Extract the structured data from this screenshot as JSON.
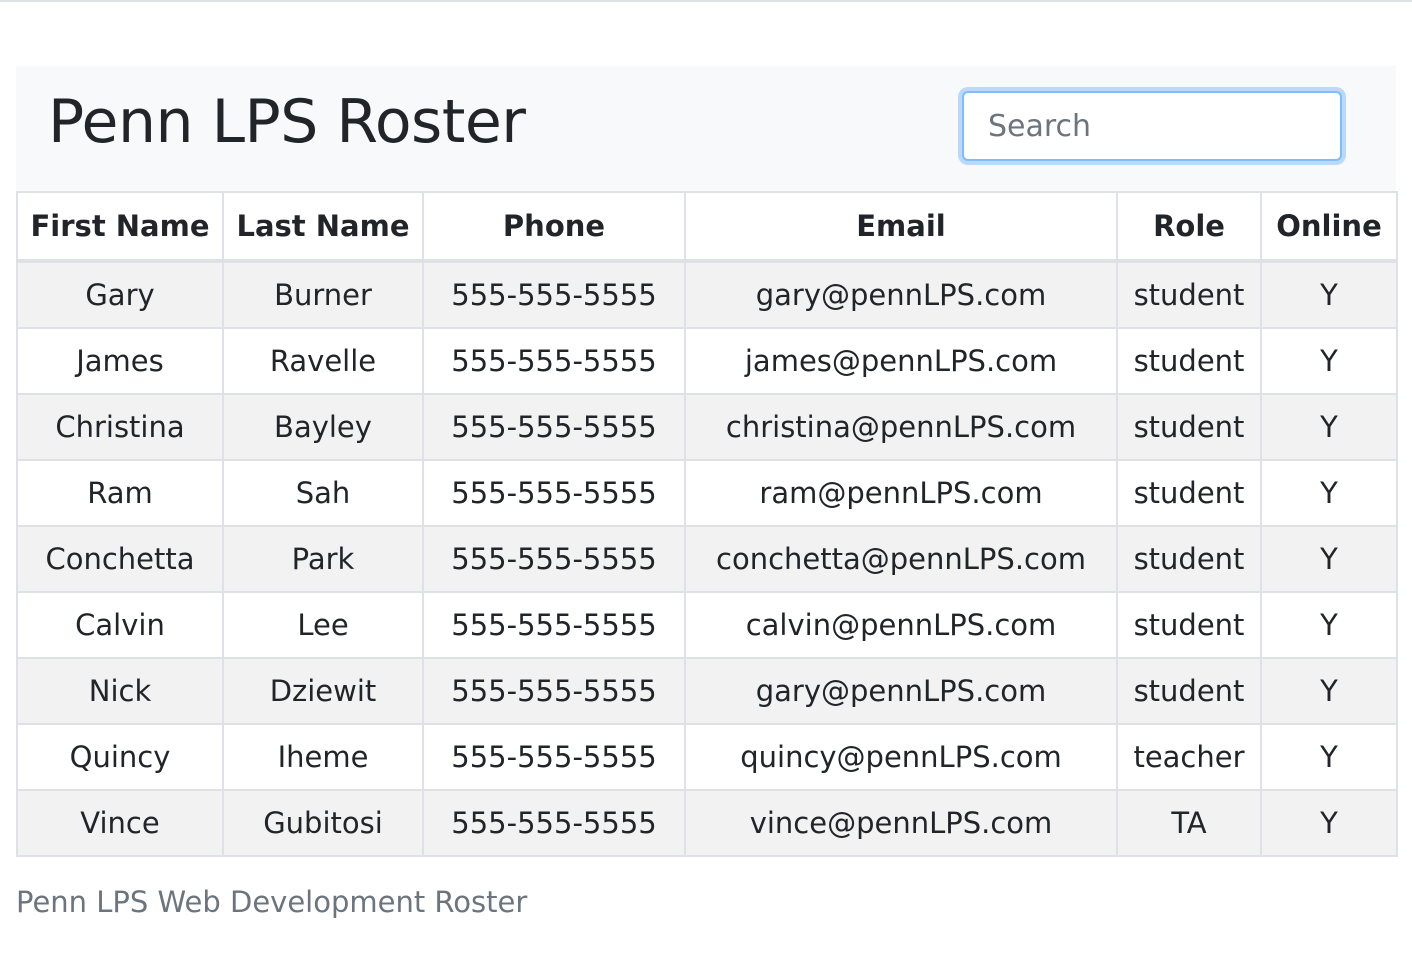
{
  "header": {
    "title": "Penn LPS Roster",
    "search_placeholder": "Search"
  },
  "table": {
    "columns": [
      "First Name",
      "Last Name",
      "Phone",
      "Email",
      "Role",
      "Online"
    ],
    "rows": [
      [
        "Gary",
        "Burner",
        "555-555-5555",
        "gary@pennLPS.com",
        "student",
        "Y"
      ],
      [
        "James",
        "Ravelle",
        "555-555-5555",
        "james@pennLPS.com",
        "student",
        "Y"
      ],
      [
        "Christina",
        "Bayley",
        "555-555-5555",
        "christina@pennLPS.com",
        "student",
        "Y"
      ],
      [
        "Ram",
        "Sah",
        "555-555-5555",
        "ram@pennLPS.com",
        "student",
        "Y"
      ],
      [
        "Conchetta",
        "Park",
        "555-555-5555",
        "conchetta@pennLPS.com",
        "student",
        "Y"
      ],
      [
        "Calvin",
        "Lee",
        "555-555-5555",
        "calvin@pennLPS.com",
        "student",
        "Y"
      ],
      [
        "Nick",
        "Dziewit",
        "555-555-5555",
        "gary@pennLPS.com",
        "student",
        "Y"
      ],
      [
        "Quincy",
        "Iheme",
        "555-555-5555",
        "quincy@pennLPS.com",
        "teacher",
        "Y"
      ],
      [
        "Vince",
        "Gubitosi",
        "555-555-5555",
        "vince@pennLPS.com",
        "TA",
        "Y"
      ]
    ],
    "caption": "Penn LPS Web Development Roster"
  },
  "colors": {
    "navbar_bg": "#f8f9fa",
    "striped_row": "#f2f2f2",
    "focus_border": "#80bdff",
    "border": "#dee2e6",
    "caption_text": "#6c757d"
  }
}
